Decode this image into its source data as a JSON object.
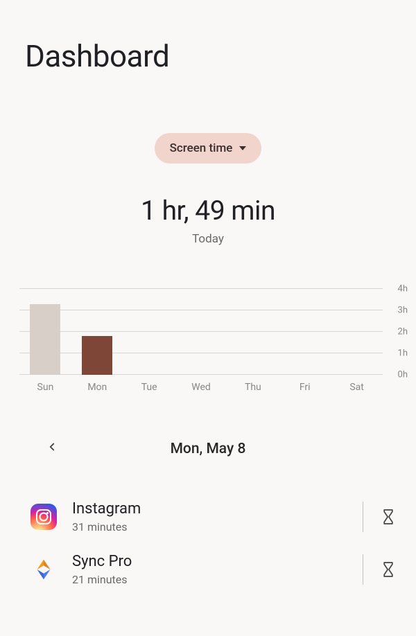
{
  "header": {
    "title": "Dashboard"
  },
  "filter": {
    "label": "Screen time"
  },
  "stat": {
    "value": "1 hr, 49 min",
    "subtext": "Today"
  },
  "chart_data": {
    "type": "bar",
    "categories": [
      "Sun",
      "Mon",
      "Tue",
      "Wed",
      "Thu",
      "Fri",
      "Sat"
    ],
    "values": [
      3.3,
      1.82,
      0,
      0,
      0,
      0,
      0
    ],
    "title": "",
    "xlabel": "",
    "ylabel": "",
    "ylim": [
      0,
      4
    ],
    "y_ticks": [
      "0h",
      "1h",
      "2h",
      "3h",
      "4h"
    ],
    "bar_colors": [
      "#d9cfc9",
      "#7d4636",
      null,
      null,
      null,
      null,
      null
    ]
  },
  "date_nav": {
    "date": "Mon, May 8"
  },
  "apps": [
    {
      "name": "Instagram",
      "duration": "31 minutes",
      "icon": "instagram"
    },
    {
      "name": "Sync Pro",
      "duration": "21 minutes",
      "icon": "syncpro"
    }
  ]
}
